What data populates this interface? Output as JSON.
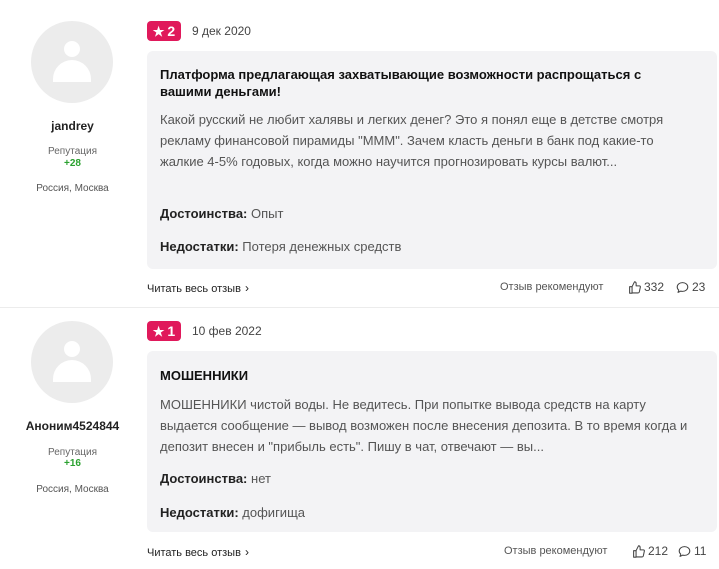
{
  "reviews": [
    {
      "user": {
        "name": "jandrey",
        "reputation_label": "Репутация",
        "reputation": "+28",
        "location": "Россия, Москва"
      },
      "rating": "2",
      "date": "9 дек 2020",
      "title": "Платформа предлагающая захватывающие возможности распрощаться с вашими деньгами!",
      "body": "Какой русский не любит халявы и легких денег? Это я понял еще в детстве смотря рекламу финансовой пирамиды \"МММ\". Зачем класть деньги в банк под какие-то жалкие 4-5% годовых, когда можно научится прогнозировать курсы валют...",
      "pros_label": "Достоинства:",
      "pros": "Опыт",
      "cons_label": "Недостатки:",
      "cons": "Потеря денежных средств",
      "read_more": "Читать весь отзыв",
      "recommend_label": "Отзыв рекомендуют",
      "likes": "332",
      "comments": "23"
    },
    {
      "user": {
        "name": "Аноним4524844",
        "reputation_label": "Репутация",
        "reputation": "+16",
        "location": "Россия, Москва"
      },
      "rating": "1",
      "date": "10 фев 2022",
      "title": "МОШЕННИКИ",
      "body": "МОШЕННИКИ чистой воды. Не ведитесь. При попытке вывода средств на карту выдается сообщение — вывод возможен после внесения депозита. В то время когда и депозит внесен и \"прибыль есть\". Пишу в чат, отвечают — вы...",
      "pros_label": "Достоинства:",
      "pros": "нет",
      "cons_label": "Недостатки:",
      "cons": "дофигища",
      "read_more": "Читать весь отзыв",
      "recommend_label": "Отзыв рекомендуют",
      "likes": "212",
      "comments": "11"
    }
  ],
  "colors": {
    "badge": "#e0195b",
    "reputation": "#2aa12f",
    "card": "#f3f3f5"
  }
}
